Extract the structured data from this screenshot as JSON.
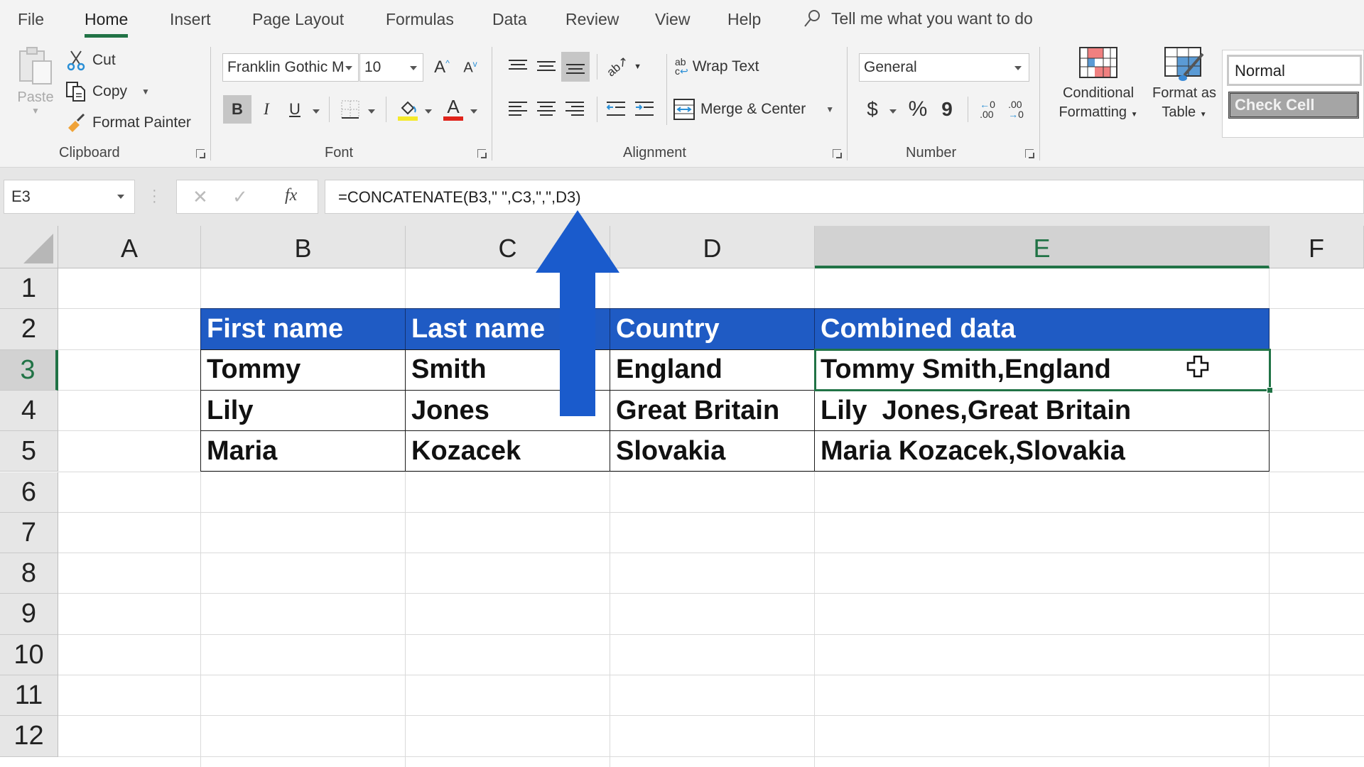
{
  "tabs": [
    {
      "label": "File",
      "active": false
    },
    {
      "label": "Home",
      "active": true
    },
    {
      "label": "Insert",
      "active": false
    },
    {
      "label": "Page Layout",
      "active": false
    },
    {
      "label": "Formulas",
      "active": false
    },
    {
      "label": "Data",
      "active": false
    },
    {
      "label": "Review",
      "active": false
    },
    {
      "label": "View",
      "active": false
    },
    {
      "label": "Help",
      "active": false
    }
  ],
  "tell_me": {
    "icon": "search-icon",
    "placeholder": "Tell me what you want to do"
  },
  "ribbon": {
    "clipboard": {
      "label": "Clipboard",
      "paste": "Paste",
      "cut": "Cut",
      "copy": "Copy",
      "format_painter": "Format Painter"
    },
    "font": {
      "label": "Font",
      "font_name": "Franklin Gothic M",
      "font_size": "10",
      "bold": "B",
      "italic": "I",
      "underline": "U",
      "fill_color": "#f5e92a",
      "font_color": "#e0241b"
    },
    "alignment": {
      "label": "Alignment",
      "wrap_text": "Wrap Text",
      "merge_center": "Merge & Center"
    },
    "number": {
      "label": "Number",
      "format": "General",
      "currency": "$",
      "percent": "%",
      "comma": "9"
    },
    "styles": {
      "conditional_formatting": [
        "Conditional",
        "Formatting"
      ],
      "format_as_table": [
        "Format as",
        "Table"
      ],
      "normal": "Normal",
      "check_cell": "Check Cell"
    }
  },
  "formula_bar": {
    "name_box": "E3",
    "fx": "fx",
    "formula": "=CONCATENATE(B3,\" \",C3,\",\",D3)"
  },
  "sheet": {
    "columns": [
      "A",
      "B",
      "C",
      "D",
      "E",
      "F"
    ],
    "selected_column": "E",
    "rows": [
      "1",
      "2",
      "3",
      "4",
      "5",
      "6",
      "7",
      "8",
      "9",
      "10",
      "11",
      "12"
    ],
    "selected_row": "3",
    "selected_cell": "E3",
    "table": {
      "header_color": "#1f5bc4",
      "headers": [
        "First name",
        "Last name",
        "Country",
        "Combined data"
      ],
      "rows": [
        [
          "Tommy",
          "Smith",
          "England",
          "Tommy Smith,England"
        ],
        [
          "Lily",
          "Jones",
          "Great Britain",
          "Lily  Jones,Great Britain"
        ],
        [
          "Maria",
          "Kozacek",
          "Slovakia",
          "Maria Kozacek,Slovakia"
        ]
      ]
    }
  },
  "annotation": {
    "type": "up-arrow",
    "color": "#1a5bcc",
    "points_to": "formula-bar"
  }
}
